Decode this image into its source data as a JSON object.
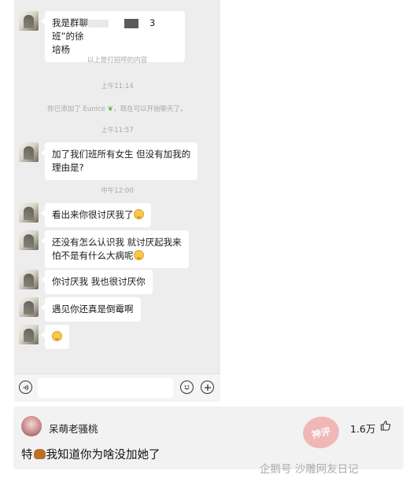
{
  "messages": [
    {
      "text_before": "我是群聊",
      "text_after": "3班”的徐",
      "line2": "培杨"
    },
    {
      "text": "加了我们班所有女生 但没有加我的",
      "line2": "理由是?"
    },
    {
      "text": "看出来你很讨厌我了"
    },
    {
      "text": "还没有怎么认识我  就讨厌起我来",
      "line2": "怕不是有什么大病呢"
    },
    {
      "text": "你讨厌我  我也很讨厌你"
    },
    {
      "text": "遇见你还真是倒霉啊"
    }
  ],
  "system": {
    "greeting_note": "以上是打招呼的内容",
    "time1": "上午11:14",
    "added_prefix": "你已添加了 Eunice",
    "added_suffix": "，现在可以开始聊天了。",
    "time2": "上午11:57",
    "time3": "中午12:00"
  },
  "input_bar": {
    "voice_icon": "voice-icon",
    "emoji_icon": "emoji-icon",
    "add_icon": "plus-icon"
  },
  "comment": {
    "username": "呆萌老骚桃",
    "likes": "1.6万",
    "text_before": "特",
    "text_after": "我知道你为啥没加她了"
  },
  "stamp": "神评",
  "watermark": "企鹅号 沙雕网友日记",
  "colors": {
    "chat_bg": "#ededed",
    "bubble": "#ffffff",
    "system_text": "#a8a8a8",
    "comment_bg": "#f2f2f2"
  }
}
